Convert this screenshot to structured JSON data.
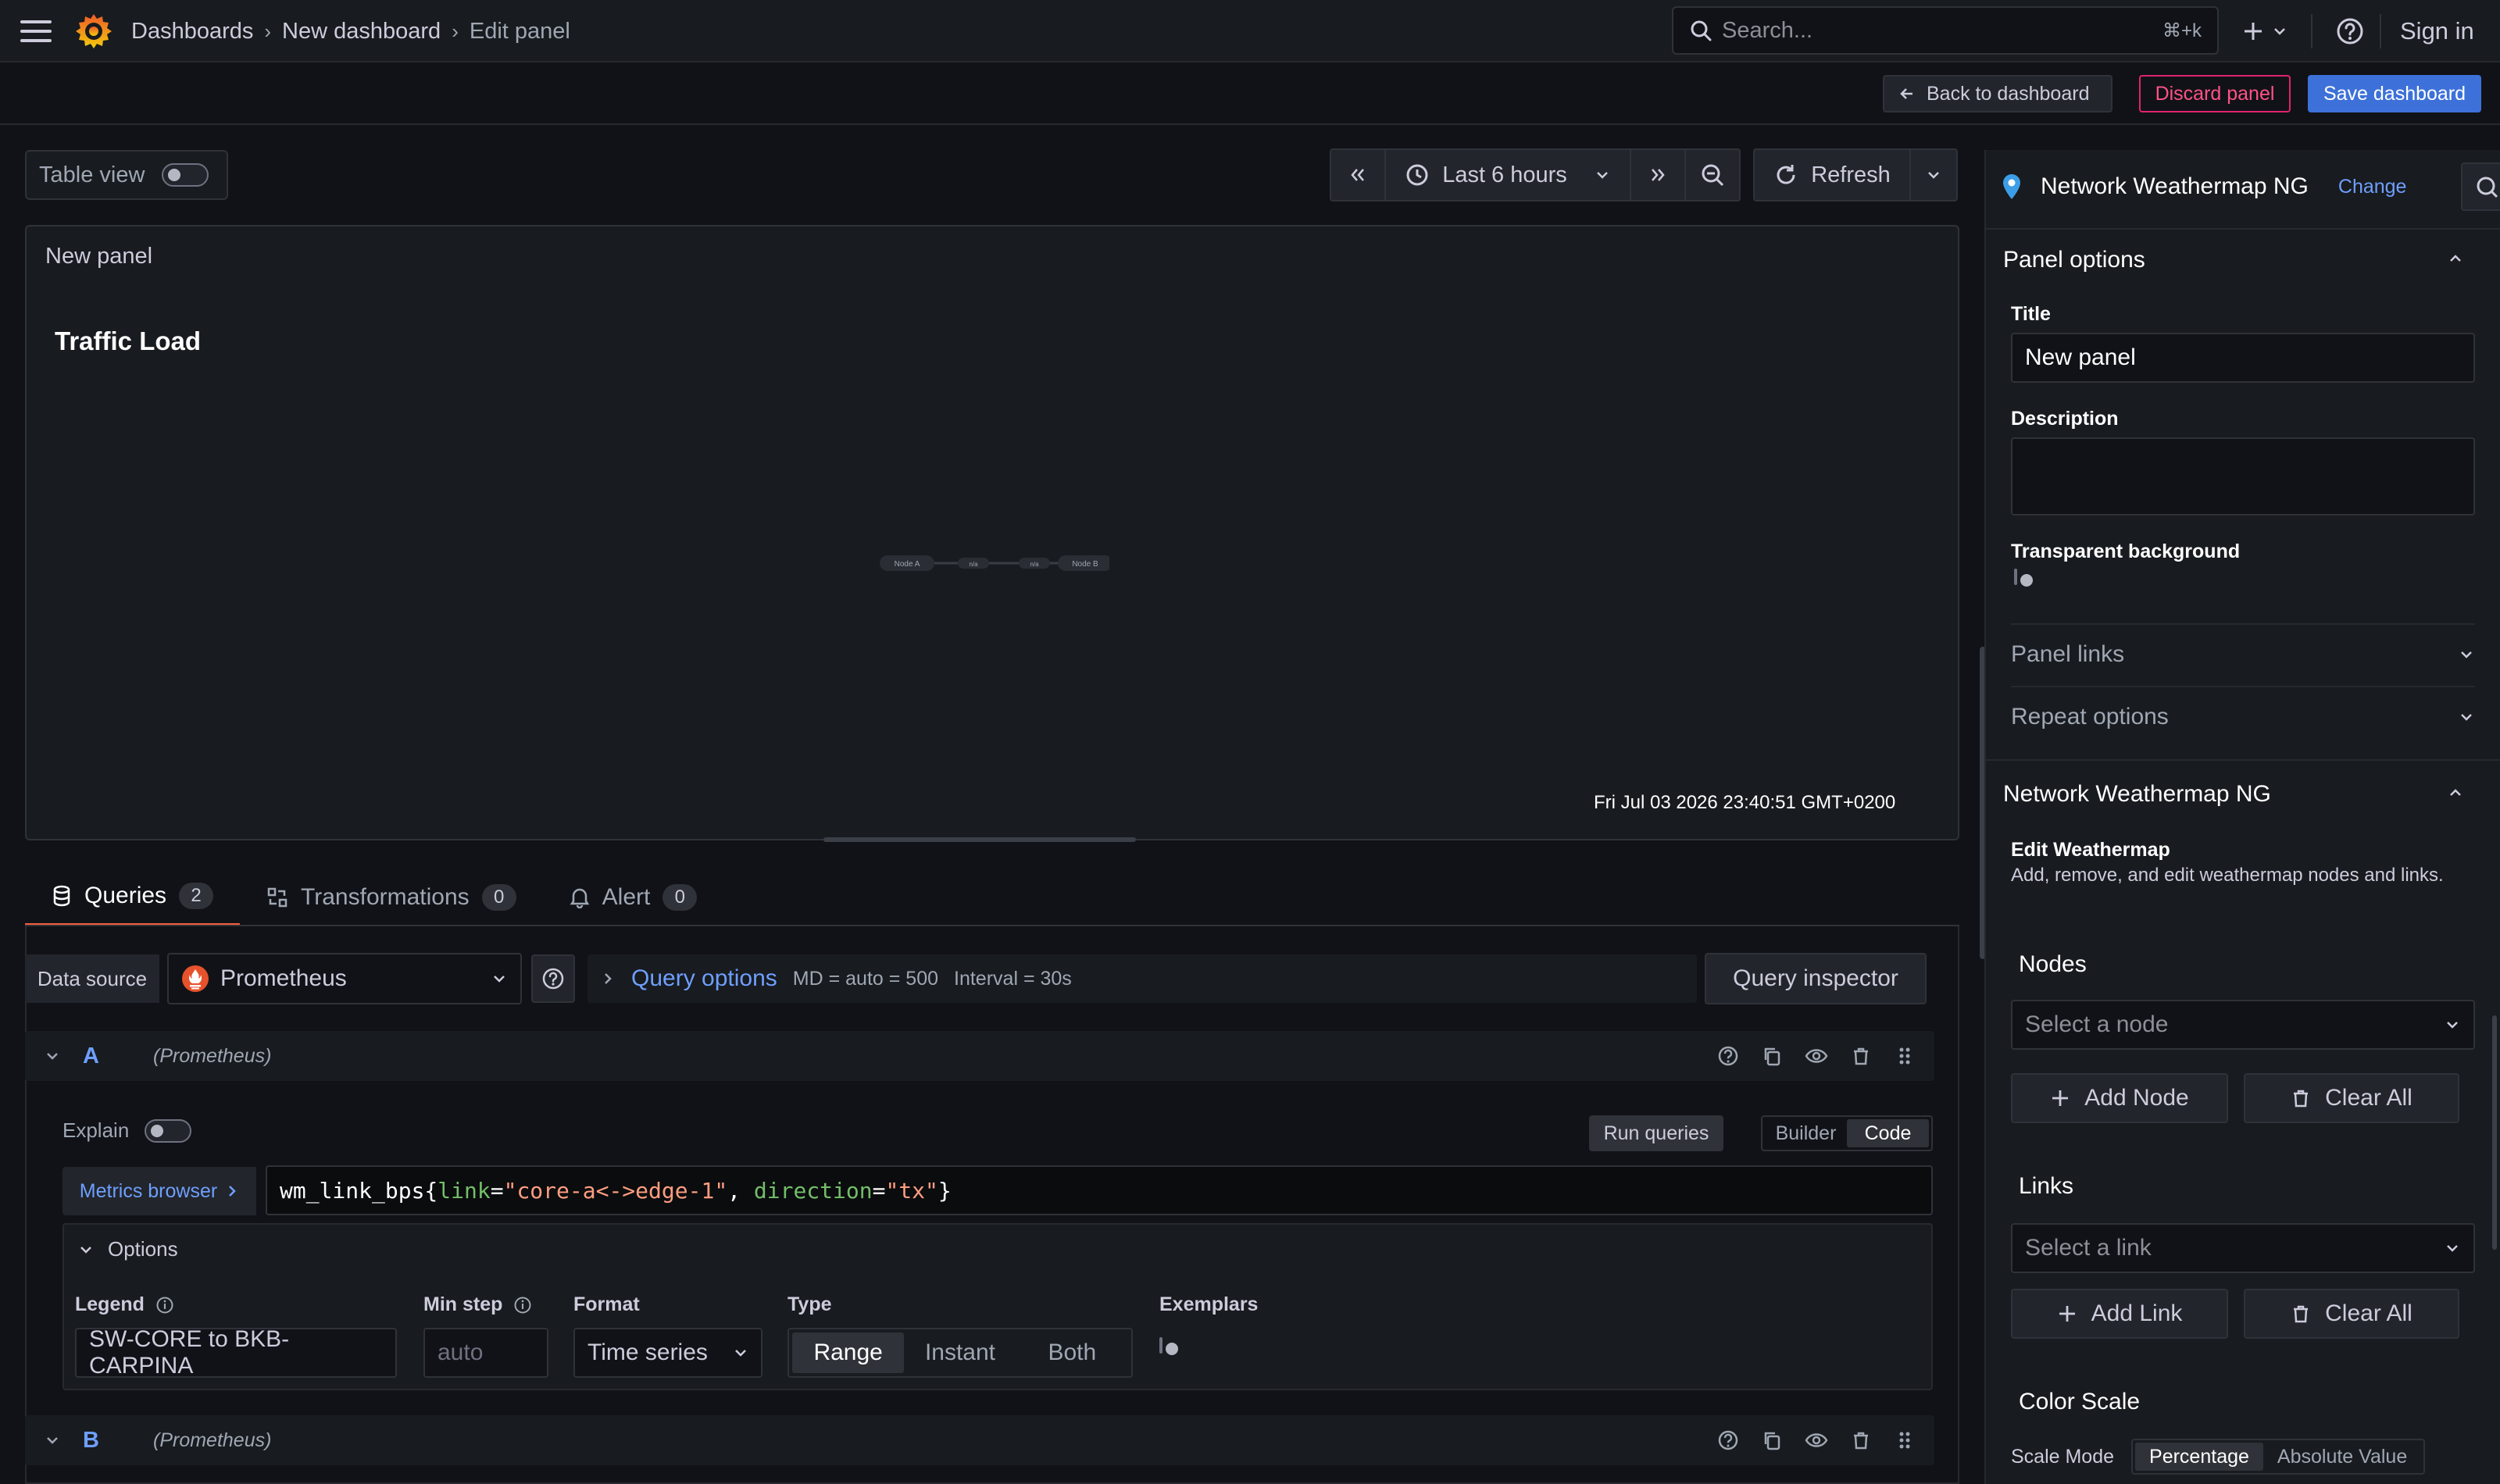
{
  "topbar": {
    "breadcrumbs": [
      "Dashboards",
      "New dashboard",
      "Edit panel"
    ],
    "search_placeholder": "Search...",
    "search_shortcut": "⌘+k",
    "sign_in": "Sign in"
  },
  "toolbar": {
    "back": "Back to dashboard",
    "discard": "Discard panel",
    "save": "Save dashboard"
  },
  "controls": {
    "table_view": "Table view",
    "time_range": "Last 6 hours",
    "refresh": "Refresh"
  },
  "panel": {
    "title": "New panel",
    "map_title": "Traffic Load",
    "node_a": "Node A",
    "node_b": "Node B",
    "link_label_1": "n/a",
    "link_label_2": "n/a",
    "timestamp": "Fri Jul 03 2026 23:40:51 GMT+0200"
  },
  "tabs": [
    {
      "label": "Queries",
      "count": "2"
    },
    {
      "label": "Transformations",
      "count": "0"
    },
    {
      "label": "Alert",
      "count": "0"
    }
  ],
  "datasource": {
    "label": "Data source",
    "value": "Prometheus",
    "query_options": "Query options",
    "md": "MD = auto = 500",
    "interval": "Interval = 30s",
    "inspector": "Query inspector"
  },
  "queryA": {
    "letter": "A",
    "source": "(Prometheus)",
    "explain": "Explain",
    "run": "Run queries",
    "builder": "Builder",
    "code": "Code",
    "metrics_browser": "Metrics browser",
    "code_metric": "wm_link_bps{",
    "code_k1": "link",
    "code_v1": "\"core-a<->edge-1\"",
    "code_sep": ", ",
    "code_k2": "direction",
    "code_v2": "\"tx\"",
    "code_end": "}",
    "options": "Options",
    "legend_label": "Legend",
    "legend_value": "SW-CORE to BKB-CARPINA",
    "minstep_label": "Min step",
    "minstep_placeholder": "auto",
    "format_label": "Format",
    "format_value": "Time series",
    "type_label": "Type",
    "type_options": [
      "Range",
      "Instant",
      "Both"
    ],
    "exemplars_label": "Exemplars"
  },
  "queryB": {
    "letter": "B",
    "source": "(Prometheus)"
  },
  "sidebar": {
    "viz_name": "Network Weathermap NG",
    "change": "Change",
    "panel_options": "Panel options",
    "title_label": "Title",
    "title_value": "New panel",
    "description_label": "Description",
    "transparent_label": "Transparent background",
    "panel_links": "Panel links",
    "repeat_options": "Repeat options",
    "plugin_section": "Network Weathermap NG",
    "edit_title": "Edit Weathermap",
    "edit_desc": "Add, remove, and edit weathermap nodes and links.",
    "nodes_label": "Nodes",
    "node_select": "Select a node",
    "add_node": "Add Node",
    "clear_all_nodes": "Clear All",
    "links_label": "Links",
    "link_select": "Select a link",
    "add_link": "Add Link",
    "clear_all_links": "Clear All",
    "color_scale": "Color Scale",
    "scale_mode": "Scale Mode",
    "scale_options": [
      "Percentage",
      "Absolute Value"
    ]
  },
  "colors": {
    "background": "#111217",
    "panel": "#181b1f",
    "accent_blue": "#3d71d9",
    "link_blue": "#6e9fff",
    "discard_pink": "#ff5286",
    "tab_underline": "#f55f3e"
  }
}
